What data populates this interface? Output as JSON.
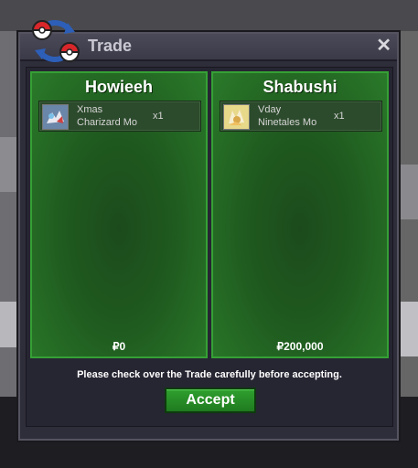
{
  "window": {
    "title": "Trade",
    "close_label": "✕"
  },
  "trade": {
    "left": {
      "player": "Howieeh",
      "item": {
        "line1": "Xmas",
        "line2": "Charizard Mo",
        "qty": "x1"
      },
      "money": "₽0"
    },
    "right": {
      "player": "Shabushi",
      "item": {
        "line1": "Vday",
        "line2": "Ninetales Mo",
        "qty": "x1"
      },
      "money": "₽200,000"
    }
  },
  "notice": "Please check over the Trade carefully before accepting.",
  "accept_label": "Accept",
  "colors": {
    "panel_green": "#1f5a1f",
    "border_green": "#35a035",
    "accept_green": "#2fa02f"
  },
  "icons": {
    "logo": "pokeball-swap-icon",
    "close": "close-icon"
  }
}
